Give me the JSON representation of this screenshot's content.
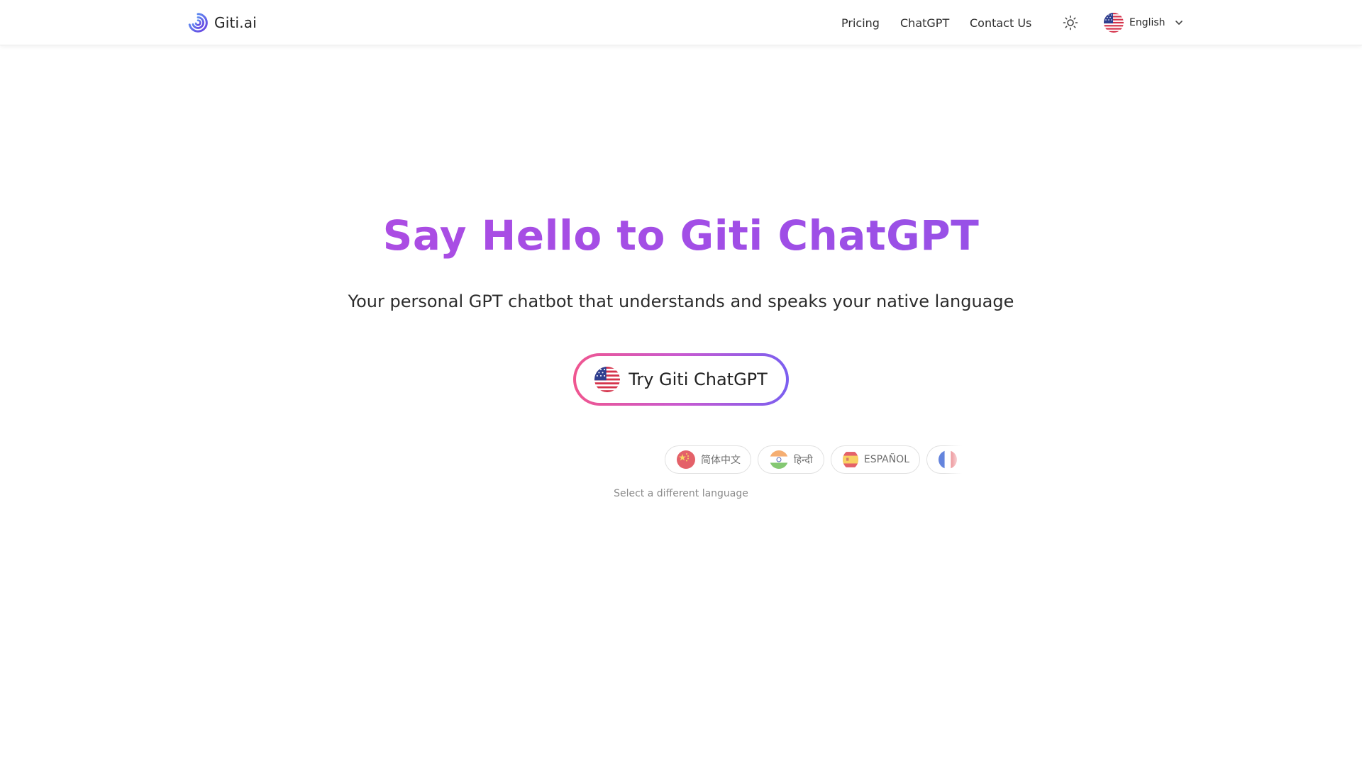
{
  "header": {
    "logo_text": "Giti.ai",
    "nav": {
      "pricing": "Pricing",
      "chatgpt": "ChatGPT",
      "contact": "Contact Us"
    },
    "theme_icon": "sun-icon",
    "language_select": {
      "label": "English",
      "flag": "us-flag-icon",
      "chevron": "chevron-down-icon"
    }
  },
  "hero": {
    "title": "Say Hello to Giti ChatGPT",
    "subtitle": "Your personal GPT chatbot that understands and speaks your native language",
    "cta_label": "Try Giti ChatGPT",
    "title_gradient": [
      "#b74be0",
      "#8a55e8"
    ],
    "cta_border_gradient": [
      "#f0568f",
      "#c85ad0",
      "#7b5ff0"
    ]
  },
  "languages": {
    "chips": [
      {
        "label": "简体中文",
        "flag": "china-flag-icon"
      },
      {
        "label": "हिन्दी",
        "flag": "india-flag-icon"
      },
      {
        "label": "ESPAÑOL",
        "flag": "spain-flag-icon"
      },
      {
        "label": "",
        "flag": "france-flag-icon"
      }
    ],
    "hint": "Select a different language"
  }
}
